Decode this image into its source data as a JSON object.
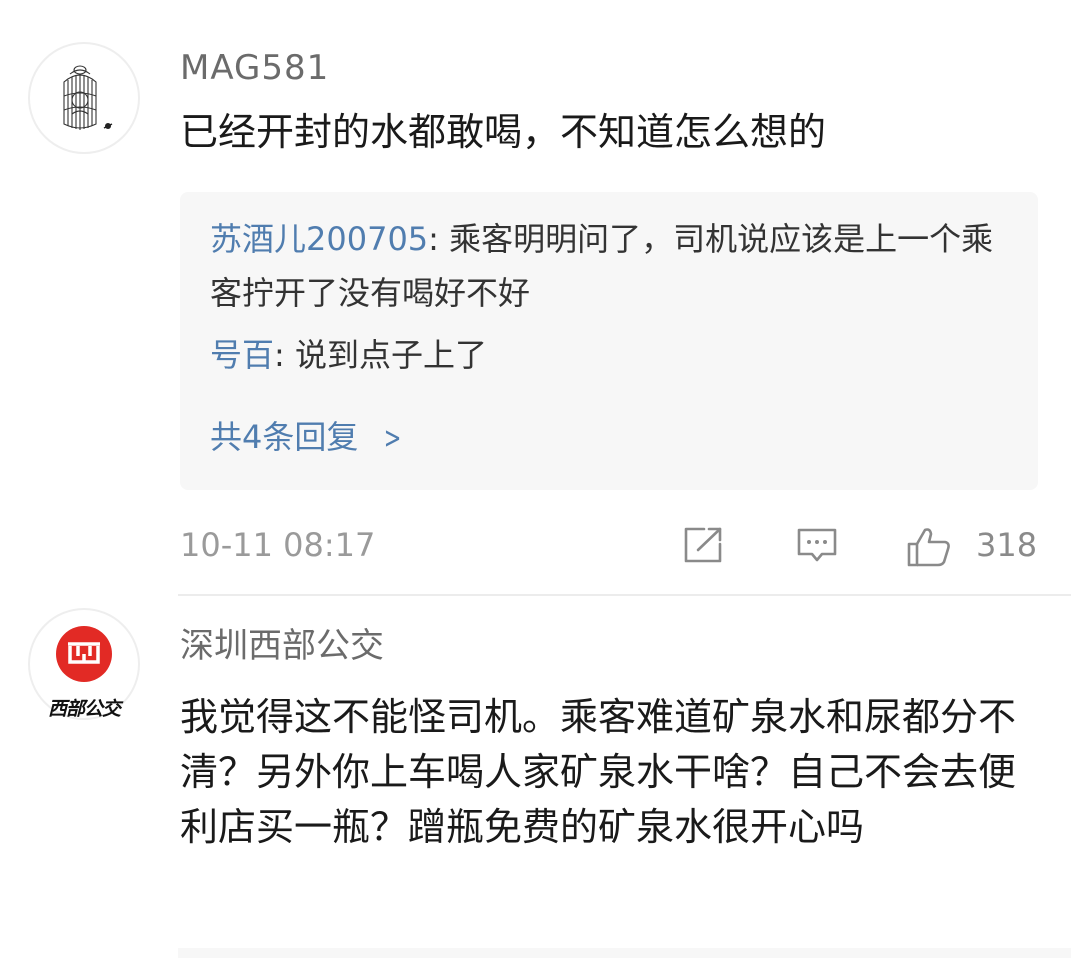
{
  "comments": [
    {
      "username": "MAG581",
      "text": "已经开封的水都敢喝，不知道怎么想的",
      "replies": [
        {
          "name": "苏酒儿200705",
          "text": ": 乘客明明问了，司机说应该是上一个乘客拧开了没有喝好不好"
        },
        {
          "name": "号百",
          "text": ": 说到点子上了"
        }
      ],
      "more_replies": "共4条回复",
      "timestamp": "10-11 08:17",
      "likes": "318"
    },
    {
      "username": "深圳西部公交",
      "avatar_text": "西部公交",
      "text": "我觉得这不能怪司机。乘客难道矿泉水和尿都分不清？另外你上车喝人家矿泉水干啥？自己不会去便利店买一瓶？蹭瓶免费的矿泉水很开心吗"
    }
  ],
  "colors": {
    "link": "#507daf",
    "muted": "#9a9a9a",
    "reply_bg": "#f7f7f7",
    "logo_red": "#e22a25"
  },
  "icons": [
    "share-icon",
    "comment-icon",
    "thumbs-up-icon",
    "chevron-right-icon"
  ]
}
